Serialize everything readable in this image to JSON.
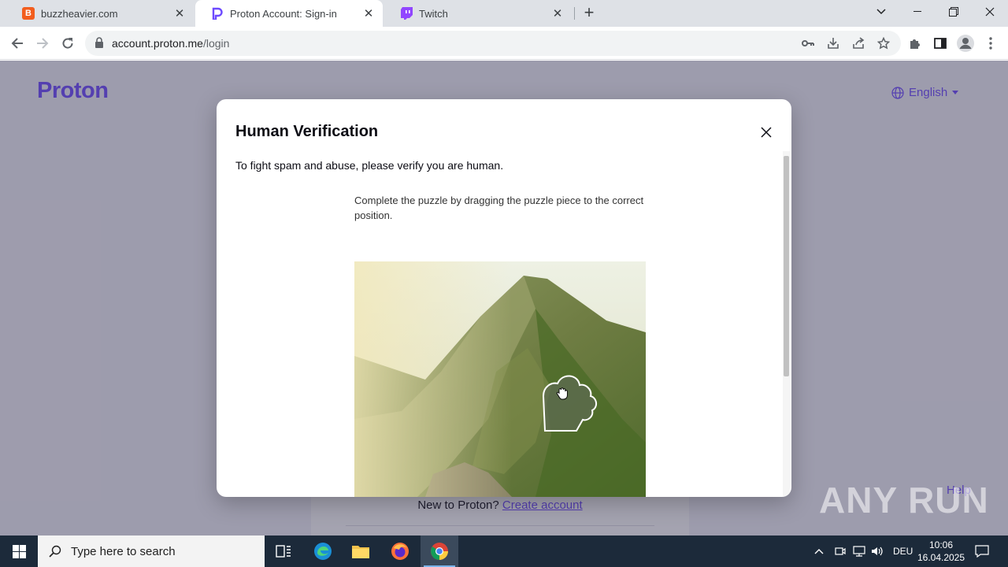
{
  "browser": {
    "tabs": [
      {
        "title": "buzzheavier.com",
        "favicon": "B",
        "favicon_color": "#f25d1d",
        "active": false
      },
      {
        "title": "Proton Account: Sign-in",
        "favicon": "P",
        "favicon_color": "#6d4aff",
        "active": true
      },
      {
        "title": "Twitch",
        "favicon": "twitch",
        "favicon_color": "#9146ff",
        "active": false
      }
    ],
    "url_host": "account.proton.me",
    "url_path": "/login"
  },
  "page": {
    "logo": "Proton",
    "language": "English",
    "new_to_proton": "New to Proton?",
    "create_account": "Create account",
    "help": "Help"
  },
  "modal": {
    "title": "Human Verification",
    "subtitle": "To fight spam and abuse, please verify you are human.",
    "instruction": "Complete the puzzle by dragging the puzzle piece to the correct position."
  },
  "taskbar": {
    "search_placeholder": "Type here to search",
    "language": "DEU",
    "time": "10:06",
    "date": "16.04.2025"
  },
  "watermark": "ANY RUN",
  "colors": {
    "brand": "#6d4aff",
    "taskbar": "#1c2a3a",
    "tabstrip": "#dee1e6"
  }
}
